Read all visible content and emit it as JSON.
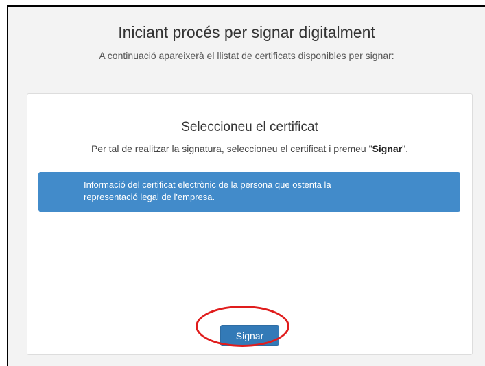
{
  "header": {
    "title": "Iniciant procés per signar digitalment",
    "subtitle": "A continuació apareixerà el llistat de certificats disponibles per signar:"
  },
  "panel": {
    "title": "Seleccioneu el certificat",
    "instruction_prefix": "Per tal de realitzar la signatura, seleccioneu el certificat i premeu \"",
    "instruction_bold": "Signar",
    "instruction_suffix": "\".",
    "certificate_line1": "Informació del certificat electrònic de la persona que ostenta la",
    "certificate_line2": "representació legal de l'empresa.",
    "sign_button": "Signar"
  },
  "colors": {
    "certificate_box": "#428bca",
    "button": "#337ab7",
    "highlight": "#e01d1d"
  }
}
